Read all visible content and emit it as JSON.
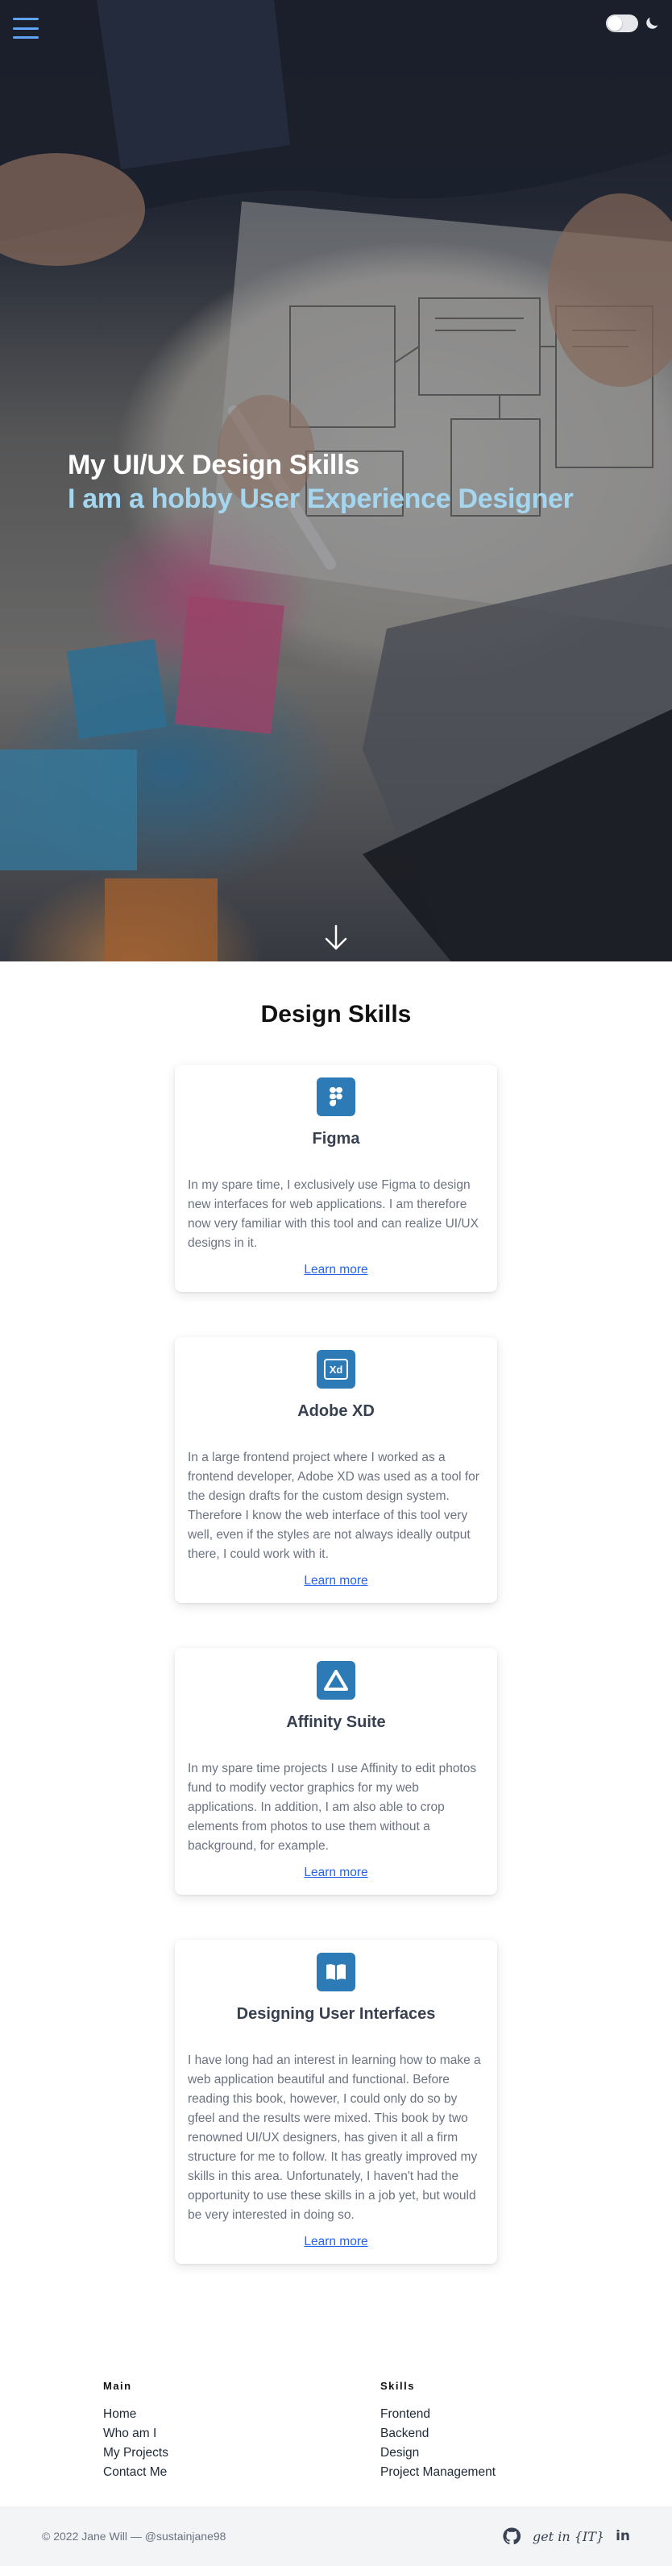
{
  "header": {
    "menu_icon": "hamburger-menu-icon",
    "theme_toggle_state": "light",
    "moon_icon": "moon-icon"
  },
  "hero": {
    "title": "My UI/UX Design Skills",
    "subtitle": "I am a hobby User Experience Designer",
    "scroll_icon": "arrow-down-icon"
  },
  "skills": {
    "title": "Design Skills",
    "accent_color": "#2c7bb6",
    "cards": [
      {
        "icon": "figma-icon",
        "title": "Figma",
        "text": "In my spare time, I exclusively use Figma to design new interfaces for web applications. I am therefore now very familiar with this tool and can realize UI/UX designs in it.",
        "link": "Learn more"
      },
      {
        "icon": "adobe-xd-icon",
        "icon_text": "Xd",
        "title": "Adobe XD",
        "text": "In a large frontend project where I worked as a frontend developer, Adobe XD was used as a tool for the design drafts for the custom design system. Therefore I know the web interface of this tool very well, even if the styles are not always ideally output there, I could work with it.",
        "link": "Learn more"
      },
      {
        "icon": "affinity-icon",
        "title": "Affinity Suite",
        "text": "In my spare time projects I use Affinity to edit photos fund to modify vector graphics for my web applications. In addition, I am also able to crop elements from photos to use them without a background, for example.",
        "link": "Learn more"
      },
      {
        "icon": "book-icon",
        "title": "Designing User Interfaces",
        "text": "I have long had an interest in learning how to make a web application beautiful and functional. Before reading this book, however, I could only do so by gfeel and the results were mixed. This book by two renowned UI/UX designers, has given it all a firm structure for me to follow. It has greatly improved my skills in this area. Unfortunately, I haven't had the opportunity to use these skills in a job yet, but would be very interested in doing so.",
        "link": "Learn more"
      }
    ]
  },
  "footer": {
    "columns": [
      {
        "heading": "Main",
        "links": [
          "Home",
          "Who am I",
          "My Projects",
          "Contact Me"
        ]
      },
      {
        "heading": "Skills",
        "links": [
          "Frontend",
          "Backend",
          "Design",
          "Project Management"
        ]
      }
    ],
    "copyright": "© 2022 Jane Will — @sustainjane98",
    "social": {
      "github_icon": "github-icon",
      "getintt_label": "get in {IT}",
      "linkedin_label": "in"
    }
  }
}
